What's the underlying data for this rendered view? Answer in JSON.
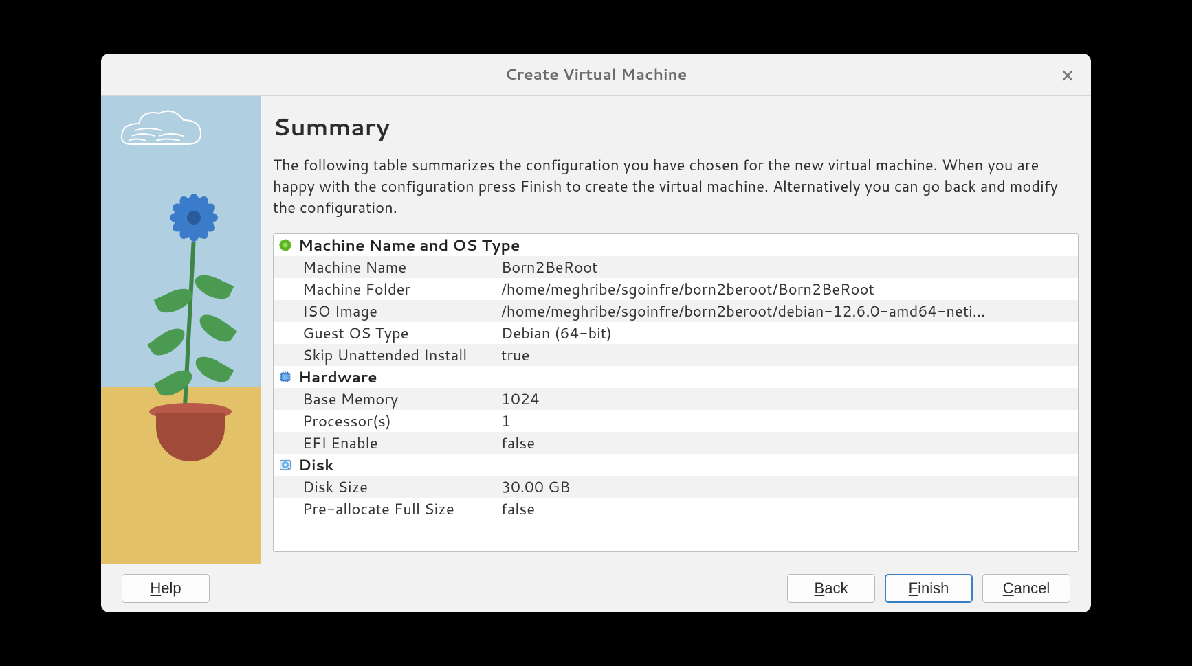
{
  "window": {
    "title": "Create Virtual Machine",
    "close_tooltip": "Close"
  },
  "page": {
    "title": "Summary",
    "description": "The following table summarizes the configuration you have chosen for the new virtual machine. When you are happy with the configuration press Finish to create the virtual machine. Alternatively you can go back and modify the configuration."
  },
  "sections": {
    "name_os": {
      "header": "Machine Name and OS Type",
      "rows": {
        "machine_name": {
          "label": "Machine Name",
          "value": "Born2BeRoot"
        },
        "machine_folder": {
          "label": "Machine Folder",
          "value": "/home/meghribe/sgoinfre/born2beroot/Born2BeRoot"
        },
        "iso_image": {
          "label": "ISO Image",
          "value": "/home/meghribe/sgoinfre/born2beroot/debian-12.6.0-amd64-neti…"
        },
        "guest_os": {
          "label": "Guest OS Type",
          "value": "Debian (64-bit)"
        },
        "skip_unattended": {
          "label": "Skip Unattended Install",
          "value": "true"
        }
      }
    },
    "hardware": {
      "header": "Hardware",
      "rows": {
        "base_memory": {
          "label": "Base Memory",
          "value": "1024"
        },
        "processors": {
          "label": "Processor(s)",
          "value": "1"
        },
        "efi": {
          "label": "EFI Enable",
          "value": "false"
        }
      }
    },
    "disk": {
      "header": "Disk",
      "rows": {
        "disk_size": {
          "label": "Disk Size",
          "value": "30.00 GB"
        },
        "preallocate": {
          "label": "Pre-allocate Full Size",
          "value": "false"
        }
      }
    }
  },
  "buttons": {
    "help": "Help",
    "back": "Back",
    "finish": "Finish",
    "cancel": "Cancel"
  }
}
